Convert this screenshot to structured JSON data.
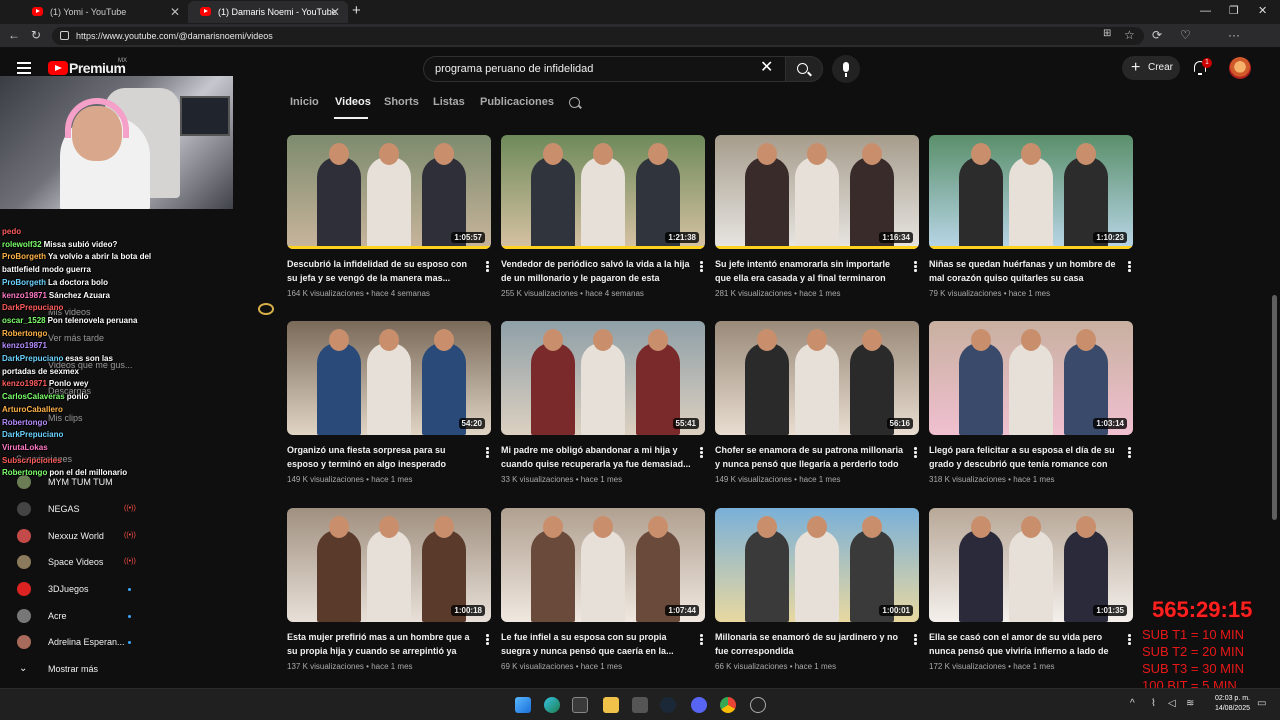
{
  "browser": {
    "tabs": [
      {
        "title": "(1) Yomi - YouTube"
      },
      {
        "title": "(1) Damaris Noemi - YouTube"
      }
    ],
    "url": "https://www.youtube.com/@damarisnoemi/videos"
  },
  "header": {
    "brand": "Premium",
    "region": "MX",
    "search_query": "programa peruano de infidelidad",
    "create_label": "Crear",
    "notifications_count": "1"
  },
  "channel_tabs": [
    "Inicio",
    "Videos",
    "Shorts",
    "Listas",
    "Publicaciones"
  ],
  "videos": [
    {
      "title": "Descubrió la infidelidad de su esposo con su jefa y se vengó de la manera mas...",
      "duration": "1:05:57",
      "views": "164 K visualizaciones",
      "ago": "hace 4 semanas",
      "watched": 1.0
    },
    {
      "title": "Vendedor de periódico salvó la vida a la hija de un millonario y le pagaron de esta manera",
      "duration": "1:21:38",
      "views": "255 K visualizaciones",
      "ago": "hace 4 semanas",
      "watched": 1.0
    },
    {
      "title": "Su jefe intentó enamorarla sin importarle que ella era casada y al final terminaron de...",
      "duration": "1:16:34",
      "views": "281 K visualizaciones",
      "ago": "hace 1 mes",
      "watched": 1.0
    },
    {
      "title": "Niñas se quedan huérfanas y un hombre de mal corazón quiso quitarles su casa",
      "duration": "1:10:23",
      "views": "79 K visualizaciones",
      "ago": "hace 1 mes",
      "watched": 1.0
    },
    {
      "title": "Organizó una fiesta sorpresa para su esposo y terminó en algo inesperado",
      "duration": "54:20",
      "views": "149 K visualizaciones",
      "ago": "hace 1 mes",
      "watched": 0
    },
    {
      "title": "Mi padre me obligó abandonar a mi hija y cuando quise recuperarla ya fue demasiad...",
      "duration": "55:41",
      "views": "33 K visualizaciones",
      "ago": "hace 1 mes",
      "watched": 0
    },
    {
      "title": "Chofer se enamora de su patrona millonaria y nunca pensó que llegaría a perderlo todo",
      "duration": "56:16",
      "views": "149 K visualizaciones",
      "ago": "hace 1 mes",
      "watched": 0
    },
    {
      "title": "Llegó para felicitar a su esposa el día de su grado y descubrió que tenía romance con s...",
      "duration": "1:03:14",
      "views": "318 K visualizaciones",
      "ago": "hace 1 mes",
      "watched": 0
    },
    {
      "title": "Esta mujer prefirió mas a un hombre que a su propia hija y cuando se arrepintió ya era...",
      "duration": "1:00:18",
      "views": "137 K visualizaciones",
      "ago": "hace 1 mes",
      "watched": 0
    },
    {
      "title": "Le fue infiel a su esposa con su propia suegra y nunca pensó que caería en la...",
      "duration": "1:07:44",
      "views": "69 K visualizaciones",
      "ago": "hace 1 mes",
      "watched": 0
    },
    {
      "title": "Millonaria se enamoró de su jardinero y no fue correspondida",
      "duration": "1:00:01",
      "views": "66 K visualizaciones",
      "ago": "hace 1 mes",
      "watched": 0
    },
    {
      "title": "Ella se casó con el amor de su vida pero nunca pensó que viviría infierno a lado de él.",
      "duration": "1:01:35",
      "views": "172 K visualizaciones",
      "ago": "hace 1 mes",
      "watched": 0
    }
  ],
  "sidebar": {
    "faded_items": [
      "Mis videos",
      "Ver más tarde",
      "Videos que me gus...",
      "Descargas",
      "Mis clips",
      "Suscripciones"
    ],
    "subscriptions": [
      {
        "name": "MYM TUM TUM",
        "indicator": ""
      },
      {
        "name": "NEGAS",
        "indicator": "((•))"
      },
      {
        "name": "Nexxuz World",
        "indicator": "((•))"
      },
      {
        "name": "Space Videos",
        "indicator": "((•))"
      },
      {
        "name": "3DJuegos",
        "indicator": "dot"
      },
      {
        "name": "Acre",
        "indicator": "dot"
      },
      {
        "name": "Adrelina Esperan...",
        "indicator": "dot"
      }
    ],
    "show_more": "Mostrar más"
  },
  "chat": [
    {
      "user": "pedo",
      "msg": ""
    },
    {
      "user": "rolewolf32",
      "msg": "Missa subió video?"
    },
    {
      "user": "ProBorgeth",
      "msg": "Ya volvio a abrir la bota del"
    },
    {
      "user": "",
      "msg": "battlefield  modo guerra"
    },
    {
      "user": "ProBorgeth",
      "msg": "La doctora bolo"
    },
    {
      "user": "kenzo19871",
      "msg": "Sánchez Azuara"
    },
    {
      "user": "DarkPrepuciano",
      "msg": ""
    },
    {
      "user": "oscar_1528",
      "msg": "Pon telenovela peruana"
    },
    {
      "user": "Robertongo",
      "msg": ""
    },
    {
      "user": "kenzo19871",
      "msg": ""
    },
    {
      "user": "DarkPrepuciano",
      "msg": "esas son las"
    },
    {
      "user": "",
      "msg": "portadas de sexmex"
    },
    {
      "user": "kenzo19871",
      "msg": "Ponlo wey"
    },
    {
      "user": "CarlosCalaveras",
      "msg": "ponlo"
    },
    {
      "user": "ArturoCaballero",
      "msg": ""
    },
    {
      "user": "Robertongo",
      "msg": ""
    },
    {
      "user": "DarkPrepuciano",
      "msg": ""
    },
    {
      "user": "VirutaLokas",
      "msg": ""
    },
    {
      "user": "Subscripciones",
      "msg": ""
    },
    {
      "user": "Robertongo",
      "msg": "pon el del millonario"
    }
  ],
  "overlay": {
    "timer": "565:29:15",
    "rules": [
      "SUB T1 = 10 MIN",
      "SUB T2 = 20 MIN",
      "SUB T3 = 30 MIN",
      "100 BIT = 5 MIN"
    ]
  },
  "taskbar": {
    "time": "02:03 p. m.",
    "date": "14/08/2025"
  },
  "colors": {
    "accent_red": "#ff0000",
    "background": "#0f0f0f",
    "timer_red": "#ff2020"
  }
}
